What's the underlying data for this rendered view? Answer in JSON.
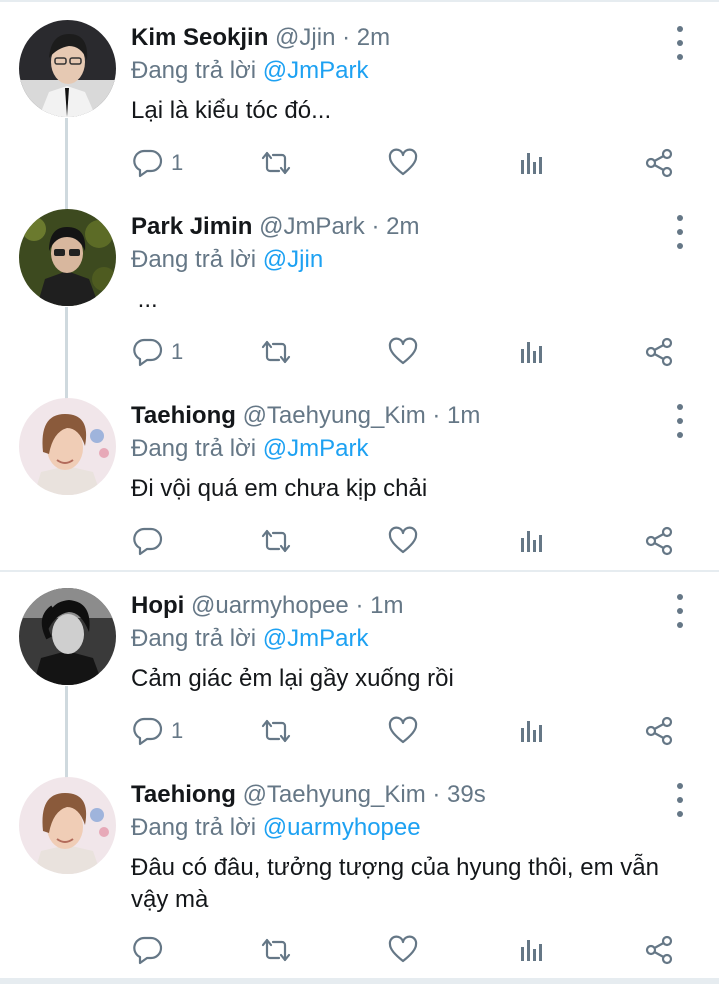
{
  "tweets": [
    {
      "name": "Kim Seokjin",
      "handle": "@Jjin",
      "time": "· 2m",
      "reply_prefix": "Đang trả lời",
      "reply_to": "@JmPark",
      "text": "Lại là kiểu tóc đó...",
      "reply_count": "1"
    },
    {
      "name": "Park Jimin",
      "handle": "@JmPark",
      "time": "· 2m",
      "reply_prefix": "Đang trả lời",
      "reply_to": "@Jjin",
      "text": " ...",
      "reply_count": "1"
    },
    {
      "name": "Taehiong",
      "handle": "@Taehyung_Kim",
      "time": "· 1m",
      "reply_prefix": "Đang trả lời",
      "reply_to": "@JmPark",
      "text": "Đi vội quá em chưa kịp chải",
      "reply_count": ""
    },
    {
      "name": "Hopi",
      "handle": "@uarmyhopee",
      "time": "· 1m",
      "reply_prefix": "Đang trả lời",
      "reply_to": "@JmPark",
      "text": "Cảm giác ẻm lại gầy xuống rồi",
      "reply_count": "1"
    },
    {
      "name": "Taehiong",
      "handle": "@Taehyung_Kim",
      "time": "· 39s",
      "reply_prefix": "Đang trả lời",
      "reply_to": "@uarmyhopee",
      "text": "Đâu có đâu, tưởng tượng của hyung thôi, em vẫn vậy mà",
      "reply_count": ""
    }
  ],
  "icons": {
    "reply": "reply-icon",
    "retweet": "retweet-icon",
    "like": "heart-icon",
    "analytics": "analytics-icon",
    "share": "share-icon",
    "more": "more-vertical-icon"
  },
  "colors": {
    "link": "#1da1f2",
    "secondary_text": "#657786",
    "primary_text": "#14171a",
    "divider": "#e6ecf0"
  }
}
